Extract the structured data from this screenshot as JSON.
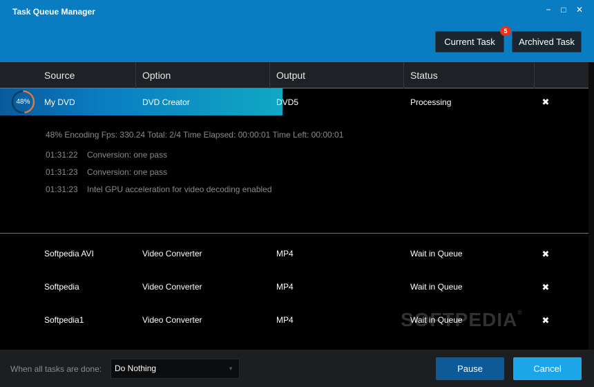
{
  "window": {
    "title": "Task Queue Manager"
  },
  "tabs": {
    "current_label": "Current Task",
    "current_badge": "5",
    "archived_label": "Archived Task"
  },
  "columns": [
    "Source",
    "Option",
    "Output",
    "Status"
  ],
  "active_task": {
    "progress_text": "48%",
    "progress_fraction": 0.48,
    "source": "My DVD",
    "option": "DVD Creator",
    "output": "DVD5",
    "status": "Processing",
    "stats": "48%  Encoding Fps: 330.24   Total: 2/4  Time Elapsed: 00:00:01  Time Left: 00:00:01",
    "log": [
      {
        "time": "01:31:22",
        "message": "Conversion: one pass"
      },
      {
        "time": "01:31:23",
        "message": "Conversion: one pass"
      },
      {
        "time": "01:31:23",
        "message": "Intel GPU acceleration for video decoding enabled"
      }
    ]
  },
  "queue": [
    {
      "source": "Softpedia AVI",
      "option": "Video Converter",
      "output": "MP4",
      "status": "Wait in Queue"
    },
    {
      "source": "Softpedia",
      "option": "Video Converter",
      "output": "MP4",
      "status": "Wait in Queue"
    },
    {
      "source": "Softpedia1",
      "option": "Video Converter",
      "output": "MP4",
      "status": "Wait in Queue"
    }
  ],
  "icons": {
    "close": "✖",
    "minimize": "−",
    "maximize": "□",
    "window_close": "✕",
    "dropdown": "▼"
  },
  "watermark": {
    "text": "SOFTPEDIA",
    "mark": "®"
  },
  "footer": {
    "when_done_label": "When all tasks are done:",
    "when_done_value": "Do Nothing",
    "pause_label": "Pause",
    "cancel_label": "Cancel"
  },
  "colors": {
    "titlebar": "#0a7cc1",
    "accent_line": "#1a9c8e",
    "progress_ring": "#e07a3a",
    "badge": "#e8321e",
    "pause_button": "#0d5a96",
    "cancel_button": "#1aa6e8"
  }
}
